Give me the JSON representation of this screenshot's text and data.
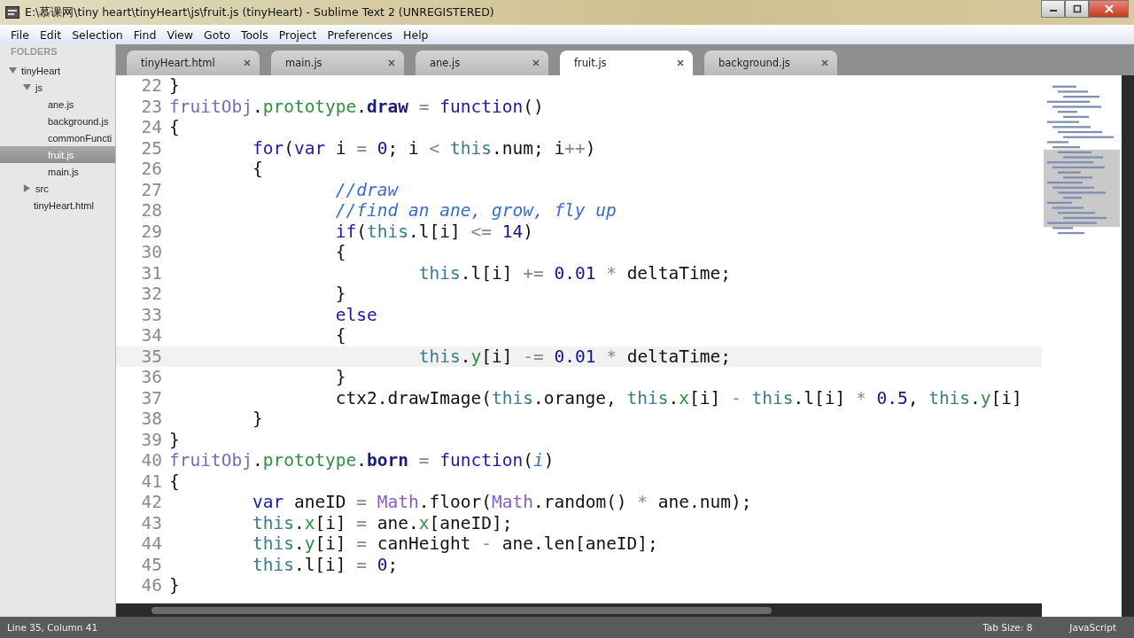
{
  "window": {
    "title": "E:\\慕课网\\tiny heart\\tinyHeart\\js\\fruit.js (tinyHeart) - Sublime Text 2 (UNREGISTERED)"
  },
  "menu": [
    "File",
    "Edit",
    "Selection",
    "Find",
    "View",
    "Goto",
    "Tools",
    "Project",
    "Preferences",
    "Help"
  ],
  "sidebar": {
    "heading": "FOLDERS",
    "items": [
      {
        "label": "tinyHeart",
        "kind": "folder",
        "expanded": true,
        "selected": false,
        "children": [
          {
            "label": "js",
            "kind": "folder",
            "expanded": true,
            "selected": false,
            "children": [
              {
                "label": "ane.js",
                "kind": "file",
                "selected": false
              },
              {
                "label": "background.js",
                "kind": "file",
                "selected": false
              },
              {
                "label": "commonFuncti",
                "kind": "file",
                "selected": false
              },
              {
                "label": "fruit.js",
                "kind": "file",
                "selected": true
              },
              {
                "label": "main.js",
                "kind": "file",
                "selected": false
              }
            ]
          },
          {
            "label": "src",
            "kind": "folder",
            "expanded": false,
            "selected": false
          },
          {
            "label": "tinyHeart.html",
            "kind": "file",
            "selected": false
          }
        ]
      }
    ]
  },
  "tabs": [
    {
      "label": "tinyHeart.html",
      "selected": false
    },
    {
      "label": "main.js",
      "selected": false
    },
    {
      "label": "ane.js",
      "selected": false
    },
    {
      "label": "fruit.js",
      "selected": true
    },
    {
      "label": "background.js",
      "selected": false
    }
  ],
  "code": [
    {
      "number": "22",
      "current": false,
      "tokens": [
        {
          "kind": "plain",
          "text": "}"
        }
      ]
    },
    {
      "number": "23",
      "current": false,
      "tokens": [
        {
          "kind": "obj",
          "text": "fruitObj"
        },
        {
          "kind": "plain",
          "text": "."
        },
        {
          "kind": "prop",
          "text": "prototype"
        },
        {
          "kind": "plain",
          "text": "."
        },
        {
          "kind": "fn",
          "text": "draw"
        },
        {
          "kind": "op",
          "text": " = "
        },
        {
          "kind": "kw",
          "text": "function"
        },
        {
          "kind": "plain",
          "text": "()"
        }
      ]
    },
    {
      "number": "24",
      "current": false,
      "tokens": [
        {
          "kind": "plain",
          "text": "{"
        }
      ]
    },
    {
      "number": "25",
      "current": false,
      "tokens": [
        {
          "kind": "kw",
          "text": "\tfor"
        },
        {
          "kind": "plain",
          "text": "("
        },
        {
          "kind": "kw",
          "text": "var"
        },
        {
          "kind": "plain",
          "text": " i "
        },
        {
          "kind": "op",
          "text": "= "
        },
        {
          "kind": "num",
          "text": "0"
        },
        {
          "kind": "plain",
          "text": "; i "
        },
        {
          "kind": "op",
          "text": "< "
        },
        {
          "kind": "this",
          "text": "this"
        },
        {
          "kind": "plain",
          "text": ".num; i"
        },
        {
          "kind": "op",
          "text": "++"
        },
        {
          "kind": "plain",
          "text": ")"
        }
      ]
    },
    {
      "number": "26",
      "current": false,
      "tokens": [
        {
          "kind": "plain",
          "text": "\t{"
        }
      ]
    },
    {
      "number": "27",
      "current": false,
      "tokens": [
        {
          "kind": "comment",
          "text": "\t\t//draw"
        }
      ]
    },
    {
      "number": "28",
      "current": false,
      "tokens": [
        {
          "kind": "comment",
          "text": "\t\t//find an ane, grow, fly up"
        }
      ]
    },
    {
      "number": "29",
      "current": false,
      "tokens": [
        {
          "kind": "kw",
          "text": "\t\tif"
        },
        {
          "kind": "plain",
          "text": "("
        },
        {
          "kind": "this",
          "text": "this"
        },
        {
          "kind": "plain",
          "text": ".l[i] "
        },
        {
          "kind": "op",
          "text": "<= "
        },
        {
          "kind": "num",
          "text": "14"
        },
        {
          "kind": "plain",
          "text": ")"
        }
      ]
    },
    {
      "number": "30",
      "current": false,
      "tokens": [
        {
          "kind": "plain",
          "text": "\t\t{"
        }
      ]
    },
    {
      "number": "31",
      "current": false,
      "tokens": [
        {
          "kind": "this",
          "text": "\t\t\tthis"
        },
        {
          "kind": "plain",
          "text": ".l[i] "
        },
        {
          "kind": "op",
          "text": "+= "
        },
        {
          "kind": "num",
          "text": "0.01"
        },
        {
          "kind": "op",
          "text": " * "
        },
        {
          "kind": "plain",
          "text": "deltaTime;"
        }
      ]
    },
    {
      "number": "32",
      "current": false,
      "tokens": [
        {
          "kind": "plain",
          "text": "\t\t}"
        }
      ]
    },
    {
      "number": "33",
      "current": false,
      "tokens": [
        {
          "kind": "kw",
          "text": "\t\telse"
        }
      ]
    },
    {
      "number": "34",
      "current": false,
      "tokens": [
        {
          "kind": "plain",
          "text": "\t\t{"
        }
      ]
    },
    {
      "number": "35",
      "current": true,
      "tokens": [
        {
          "kind": "this",
          "text": "\t\t\tthis"
        },
        {
          "kind": "plain",
          "text": "."
        },
        {
          "kind": "prop",
          "text": "y"
        },
        {
          "kind": "plain",
          "text": "[i] "
        },
        {
          "kind": "op",
          "text": "-= "
        },
        {
          "kind": "num",
          "text": "0.01"
        },
        {
          "kind": "op",
          "text": " * "
        },
        {
          "kind": "plain",
          "text": "deltaTime;"
        }
      ]
    },
    {
      "number": "36",
      "current": false,
      "tokens": [
        {
          "kind": "plain",
          "text": "\t\t}"
        }
      ]
    },
    {
      "number": "37",
      "current": false,
      "tokens": [
        {
          "kind": "plain",
          "text": "\t\tctx2.drawImage("
        },
        {
          "kind": "this",
          "text": "this"
        },
        {
          "kind": "plain",
          "text": ".orange, "
        },
        {
          "kind": "this",
          "text": "this"
        },
        {
          "kind": "plain",
          "text": "."
        },
        {
          "kind": "prop",
          "text": "x"
        },
        {
          "kind": "plain",
          "text": "[i] "
        },
        {
          "kind": "op",
          "text": "- "
        },
        {
          "kind": "this",
          "text": "this"
        },
        {
          "kind": "plain",
          "text": ".l[i] "
        },
        {
          "kind": "op",
          "text": "* "
        },
        {
          "kind": "num",
          "text": "0.5"
        },
        {
          "kind": "plain",
          "text": ", "
        },
        {
          "kind": "this",
          "text": "this"
        },
        {
          "kind": "plain",
          "text": "."
        },
        {
          "kind": "prop",
          "text": "y"
        },
        {
          "kind": "plain",
          "text": "[i]"
        }
      ]
    },
    {
      "number": "38",
      "current": false,
      "tokens": [
        {
          "kind": "plain",
          "text": "\t}"
        }
      ]
    },
    {
      "number": "39",
      "current": false,
      "tokens": [
        {
          "kind": "plain",
          "text": "}"
        }
      ]
    },
    {
      "number": "40",
      "current": false,
      "tokens": [
        {
          "kind": "obj",
          "text": "fruitObj"
        },
        {
          "kind": "plain",
          "text": "."
        },
        {
          "kind": "prop",
          "text": "prototype"
        },
        {
          "kind": "plain",
          "text": "."
        },
        {
          "kind": "fn",
          "text": "born"
        },
        {
          "kind": "op",
          "text": " = "
        },
        {
          "kind": "kw",
          "text": "function"
        },
        {
          "kind": "plain",
          "text": "("
        },
        {
          "kind": "comment",
          "text": "i"
        },
        {
          "kind": "plain",
          "text": ")"
        }
      ]
    },
    {
      "number": "41",
      "current": false,
      "tokens": [
        {
          "kind": "plain",
          "text": "{"
        }
      ]
    },
    {
      "number": "42",
      "current": false,
      "tokens": [
        {
          "kind": "kw",
          "text": "\tvar"
        },
        {
          "kind": "plain",
          "text": " aneID "
        },
        {
          "kind": "op",
          "text": "= "
        },
        {
          "kind": "builtin",
          "text": "Math"
        },
        {
          "kind": "plain",
          "text": ".floor("
        },
        {
          "kind": "builtin",
          "text": "Math"
        },
        {
          "kind": "plain",
          "text": ".random() "
        },
        {
          "kind": "op",
          "text": "* "
        },
        {
          "kind": "plain",
          "text": "ane.num);"
        }
      ]
    },
    {
      "number": "43",
      "current": false,
      "tokens": [
        {
          "kind": "this",
          "text": "\tthis"
        },
        {
          "kind": "plain",
          "text": "."
        },
        {
          "kind": "prop",
          "text": "x"
        },
        {
          "kind": "plain",
          "text": "[i] "
        },
        {
          "kind": "op",
          "text": "= "
        },
        {
          "kind": "plain",
          "text": "ane."
        },
        {
          "kind": "prop",
          "text": "x"
        },
        {
          "kind": "plain",
          "text": "[aneID];"
        }
      ]
    },
    {
      "number": "44",
      "current": false,
      "tokens": [
        {
          "kind": "this",
          "text": "\tthis"
        },
        {
          "kind": "plain",
          "text": "."
        },
        {
          "kind": "prop",
          "text": "y"
        },
        {
          "kind": "plain",
          "text": "[i] "
        },
        {
          "kind": "op",
          "text": "= "
        },
        {
          "kind": "plain",
          "text": "canHeight "
        },
        {
          "kind": "op",
          "text": "- "
        },
        {
          "kind": "plain",
          "text": "ane.len[aneID];"
        }
      ]
    },
    {
      "number": "45",
      "current": false,
      "tokens": [
        {
          "kind": "this",
          "text": "\tthis"
        },
        {
          "kind": "plain",
          "text": ".l[i] "
        },
        {
          "kind": "op",
          "text": "= "
        },
        {
          "kind": "num",
          "text": "0"
        },
        {
          "kind": "plain",
          "text": ";"
        }
      ]
    },
    {
      "number": "46",
      "current": false,
      "tokens": [
        {
          "kind": "plain",
          "text": "}"
        }
      ]
    }
  ],
  "status_bar": {
    "position": "Line 35, Column 41",
    "tab_size": "Tab Size: 8",
    "syntax": "JavaScript"
  }
}
